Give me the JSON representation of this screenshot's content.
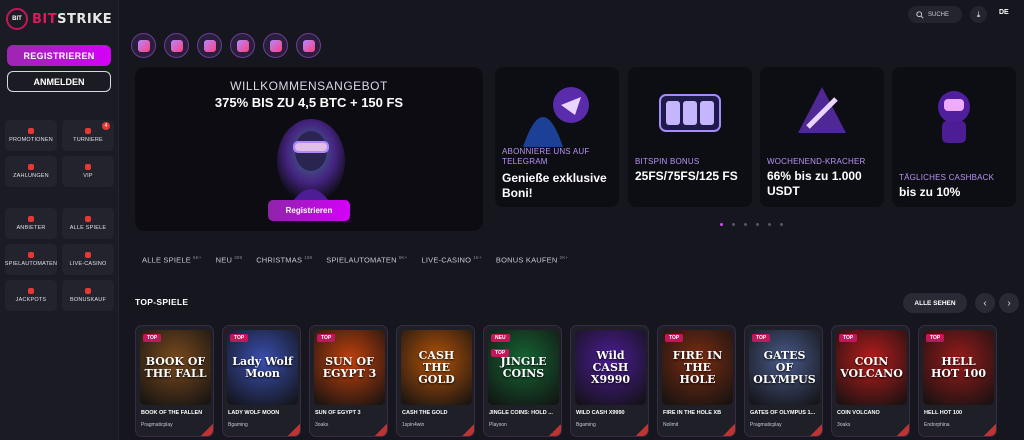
{
  "brand": {
    "badge": "BIT",
    "name_a": "BIT",
    "name_b": "STRIKE"
  },
  "auth": {
    "register": "REGISTRIEREN",
    "login": "ANMELDEN"
  },
  "sidebar": {
    "group1": [
      {
        "label": "PROMOTIONEN"
      },
      {
        "label": "TURNIERE",
        "badge": "4"
      },
      {
        "label": "ZAHLUNGEN"
      },
      {
        "label": "VIP"
      }
    ],
    "group2": [
      {
        "label": "ANBIETER"
      },
      {
        "label": "ALLE SPIELE"
      },
      {
        "label": "SPIELAUTOMATEN"
      },
      {
        "label": "LIVE-CASINO"
      },
      {
        "label": "JACKPOTS"
      },
      {
        "label": "BONUSKAUF"
      }
    ]
  },
  "topbar": {
    "search": "SUCHE",
    "lang": "DE"
  },
  "hero": {
    "title": "WILLKOMMENSANGEBOT",
    "subtitle": "375% BIS ZU 4,5 BTC + 150 FS",
    "button": "Registrieren"
  },
  "promos": [
    {
      "tag": "ABONNIERE UNS AUF TELEGRAM",
      "big": "Genieße exklusive Boni!"
    },
    {
      "tag": "BITSPIN BONUS",
      "big": "25FS/75FS/125 FS"
    },
    {
      "tag": "WOCHENEND-KRACHER",
      "big": "66% bis zu 1.000 USDT"
    },
    {
      "tag": "TÄGLICHES CASHBACK",
      "big": "bis zu 10%"
    }
  ],
  "tabs": [
    {
      "label": "ALLE SPIELE",
      "count": "5K+"
    },
    {
      "label": "NEU",
      "count": "308"
    },
    {
      "label": "CHRISTMAS",
      "count": "158"
    },
    {
      "label": "SPIELAUTOMATEN",
      "count": "6K+"
    },
    {
      "label": "LIVE-CASINO",
      "count": "1K+"
    },
    {
      "label": "BONUS KAUFEN",
      "count": "2K+"
    }
  ],
  "top_games": {
    "title": "TOP-SPIELE",
    "see_all": "ALLE SEHEN",
    "items": [
      {
        "badge": "TOP",
        "art": "BOOK OF THE FALL",
        "name": "BOOK OF THE FALLEN",
        "provider": "Pragmaticplay",
        "color": "#7a4a1e"
      },
      {
        "badge": "TOP",
        "art": "Lady Wolf Moon",
        "name": "LADY WOLF MOON",
        "provider": "Bgaming",
        "color": "#3a4fb0"
      },
      {
        "badge": "TOP",
        "art": "SUN OF EGYPT 3",
        "name": "SUN OF EGYPT 3",
        "provider": "3oaks",
        "color": "#c2410c"
      },
      {
        "badge": "",
        "art": "CASH THE GOLD",
        "name": "CASH THE GOLD",
        "provider": "1spin4win",
        "color": "#b45309"
      },
      {
        "badge": "NEU",
        "badge2": "TOP",
        "art": "JINGLE COINS",
        "name": "JINGLE COINS: HOLD ...",
        "provider": "Playson",
        "color": "#166534"
      },
      {
        "badge": "",
        "art": "Wild CASH X9990",
        "name": "WILD CASH X9990",
        "provider": "Bgaming",
        "color": "#4c1d95"
      },
      {
        "badge": "TOP",
        "art": "FIRE IN THE HOLE",
        "name": "FIRE IN THE HOLE XB",
        "provider": "Nolimit",
        "color": "#7c2d12"
      },
      {
        "badge": "TOP",
        "art": "GATES OF OLYMPUS",
        "name": "GATES OF OLYMPUS 1...",
        "provider": "Pragmaticplay",
        "color": "#4a5a8a"
      },
      {
        "badge": "TOP",
        "art": "COIN VOLCANO",
        "name": "COIN VOLCANO",
        "provider": "3oaks",
        "color": "#b91c1c"
      },
      {
        "badge": "TOP",
        "art": "HELL HOT 100",
        "name": "HELL HOT 100",
        "provider": "Endorphina",
        "color": "#991b1b"
      }
    ]
  }
}
